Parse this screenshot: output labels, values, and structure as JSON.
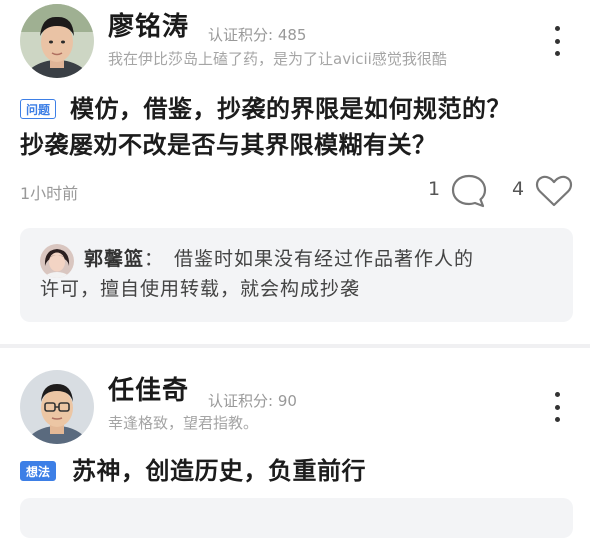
{
  "posts": [
    {
      "author": "廖铭涛",
      "score_label": "认证积分: 485",
      "bio": "我在伊比莎岛上磕了药，是为了让avicii感觉我很酷",
      "tag": "问题",
      "title_line1": "模仿，借鉴，抄袭的界限是如何规范的？",
      "title_line2": "抄袭屡劝不改是否与其界限模糊有关？",
      "time": "1小时前",
      "comments": "1",
      "likes": "4",
      "answer": {
        "author": "郭馨篮",
        "text_line1": "借鉴时如果没有经过作品著作人的",
        "text_line2": "许可，擅自使用转载，就会构成抄袭"
      }
    },
    {
      "author": "任佳奇",
      "score_label": "认证积分: 90",
      "bio": "幸逢格致，望君指教。",
      "tag": "想法",
      "title_line1": "苏神，创造历史，负重前行"
    }
  ],
  "icons": {
    "more": "more-vertical-icon",
    "comment": "comment-bubble-icon",
    "like": "heart-icon"
  },
  "colors": {
    "accent": "#3d7fe6",
    "answer_bg": "#f3f4f6",
    "muted_text": "#999999"
  }
}
